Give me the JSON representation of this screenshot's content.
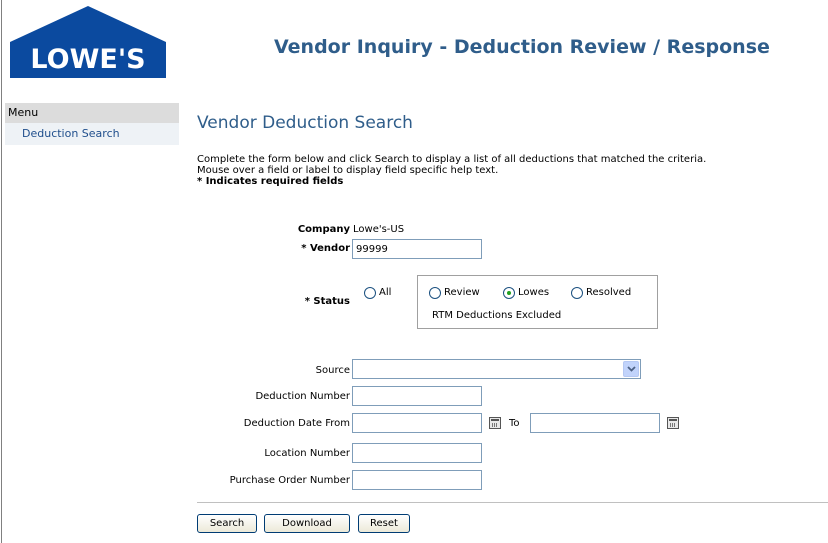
{
  "logo": {
    "text": "LOWE'S"
  },
  "header": {
    "title": "Vendor Inquiry - Deduction Review / Response"
  },
  "sidebar": {
    "heading": "Menu",
    "items": [
      {
        "label": "Deduction Search"
      }
    ]
  },
  "main": {
    "title": "Vendor Deduction Search",
    "intro_line1": "Complete the form below and click Search to display a list of all deductions that matched the criteria.",
    "intro_line2": "Mouse over a field or label to display field specific help text.",
    "required_note": "* Indicates required fields"
  },
  "form": {
    "company_label": "Company",
    "company_value": "Lowe's-US",
    "vendor_label": "* Vendor",
    "vendor_value": "99999",
    "status_label": "* Status",
    "status_options": {
      "all": "All",
      "review": "Review",
      "lowes": "Lowes",
      "resolved": "Resolved"
    },
    "status_selected": "lowes",
    "status_note": "RTM Deductions Excluded",
    "source_label": "Source",
    "source_value": "",
    "deduction_number_label": "Deduction Number",
    "deduction_number_value": "",
    "deduction_date_from_label": "Deduction Date From",
    "deduction_date_from_value": "",
    "to_label": "To",
    "deduction_date_to_value": "",
    "location_number_label": "Location Number",
    "location_number_value": "",
    "po_number_label": "Purchase Order Number",
    "po_number_value": ""
  },
  "buttons": {
    "search": "Search",
    "download": "Download",
    "reset": "Reset"
  },
  "colors": {
    "brand_blue": "#0b4a9f",
    "heading_blue": "#2f5d8a",
    "link_blue": "#1f4e8c",
    "radio_checked": "#21a121"
  },
  "icons": [
    "lowes-logo",
    "chevron-down-icon",
    "calendar-icon",
    "calendar-icon"
  ]
}
